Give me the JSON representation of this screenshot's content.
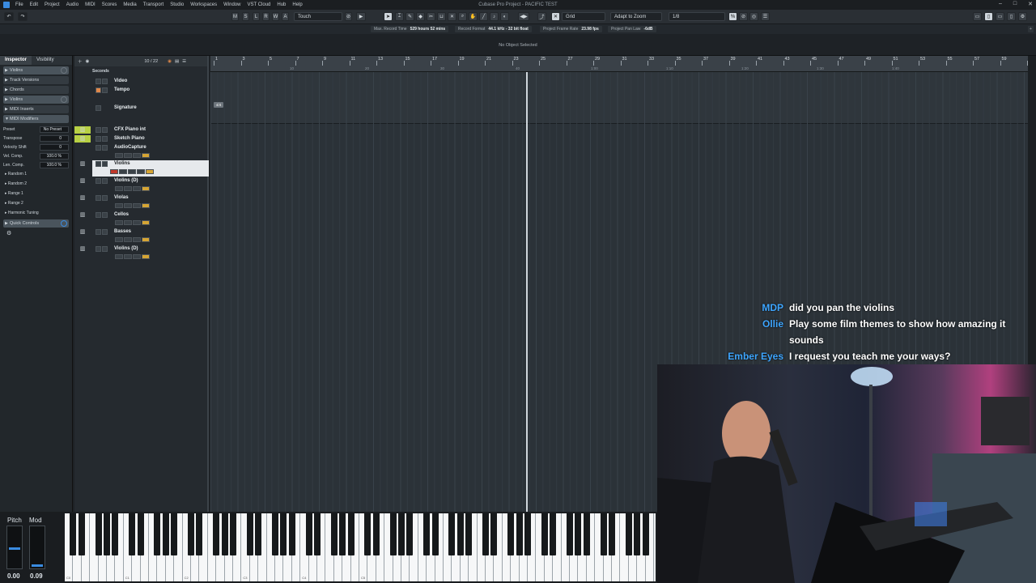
{
  "window": {
    "title": "Cubase Pro Project - PACIFIC TEST"
  },
  "menu": [
    "File",
    "Edit",
    "Project",
    "Audio",
    "MIDI",
    "Scores",
    "Media",
    "Transport",
    "Studio",
    "Workspaces",
    "Window",
    "VST Cloud",
    "Hub",
    "Help"
  ],
  "toolbar": {
    "mode_buttons": [
      "M",
      "S",
      "L",
      "R",
      "W",
      "A"
    ],
    "automation_mode": "Touch",
    "snap_type": "Grid",
    "grid_mode": "Adapt to Zoom",
    "quantize": "1/8"
  },
  "status": [
    {
      "label": "Max. Record Time",
      "value": "529 hours 52 mins"
    },
    {
      "label": "Record Format",
      "value": "44.1 kHz - 32 bit float"
    },
    {
      "label": "Project Frame Rate",
      "value": "23.98 fps"
    },
    {
      "label": "Project Pan Law",
      "value": "-6dB"
    }
  ],
  "info_line": "No Object Selected",
  "inspector": {
    "tabs": [
      "Inspector",
      "Visibility"
    ],
    "sections": [
      "Violins",
      "Track Versions",
      "Chords",
      "Violins",
      "MIDI Inserts",
      "MIDI Modifiers"
    ],
    "params": [
      {
        "label": "Preset",
        "value": "No Preset"
      },
      {
        "label": "Transpose",
        "value": "0"
      },
      {
        "label": "Velocity Shift",
        "value": "0"
      },
      {
        "label": "Vel. Comp.",
        "value": "100.0 %"
      },
      {
        "label": "Len. Comp.",
        "value": "100.0 %"
      }
    ],
    "subsections": [
      "Random 1",
      "Random 2",
      "Range 1",
      "Range 2",
      "Harmonic Tuning"
    ],
    "quick_controls": "Quick Controls"
  },
  "tracklist": {
    "header": {
      "time_display": "Seconds",
      "count": "10 / 22"
    },
    "global_tracks": [
      "Video",
      "Tempo",
      "Signature"
    ],
    "tracks": [
      "CFX Piano int",
      "Sketch Piano",
      "AudioCapture",
      "Violins",
      "Violins (D)",
      "Violas",
      "Cellos",
      "Basses",
      "Violins (D)"
    ]
  },
  "ruler": {
    "bars": [
      "1",
      "3",
      "5",
      "7",
      "9",
      "11",
      "13",
      "15",
      "17",
      "19",
      "21",
      "23",
      "25",
      "27",
      "29",
      "31",
      "33",
      "35",
      "37",
      "39",
      "41",
      "43",
      "45",
      "47",
      "49",
      "51",
      "53",
      "55",
      "57",
      "59",
      "61"
    ],
    "seconds": [
      "10",
      "20",
      "30",
      "40",
      "1:00",
      "1:10",
      "1:20",
      "1:30",
      "1:40"
    ],
    "signature": "4/4"
  },
  "keyboard": {
    "pitch_label": "Pitch",
    "mod_label": "Mod",
    "pitch_value": "0.00",
    "mod_value": "0.09",
    "c_labels": [
      "C0",
      "C1",
      "C2",
      "C3",
      "C4",
      "C5"
    ]
  },
  "chat": [
    {
      "user": "MDP",
      "text": "did you pan the violins"
    },
    {
      "user": "Ollie",
      "text": "Play some film themes to show how amazing it sounds"
    },
    {
      "user": "Ember Eyes",
      "text": "I request you teach me your ways?"
    }
  ],
  "colors": {
    "accent": "#3a8be0",
    "track_color": "#b8d044",
    "chat_name": "#3ea6ff",
    "selected_track": "#e6e9ec"
  }
}
